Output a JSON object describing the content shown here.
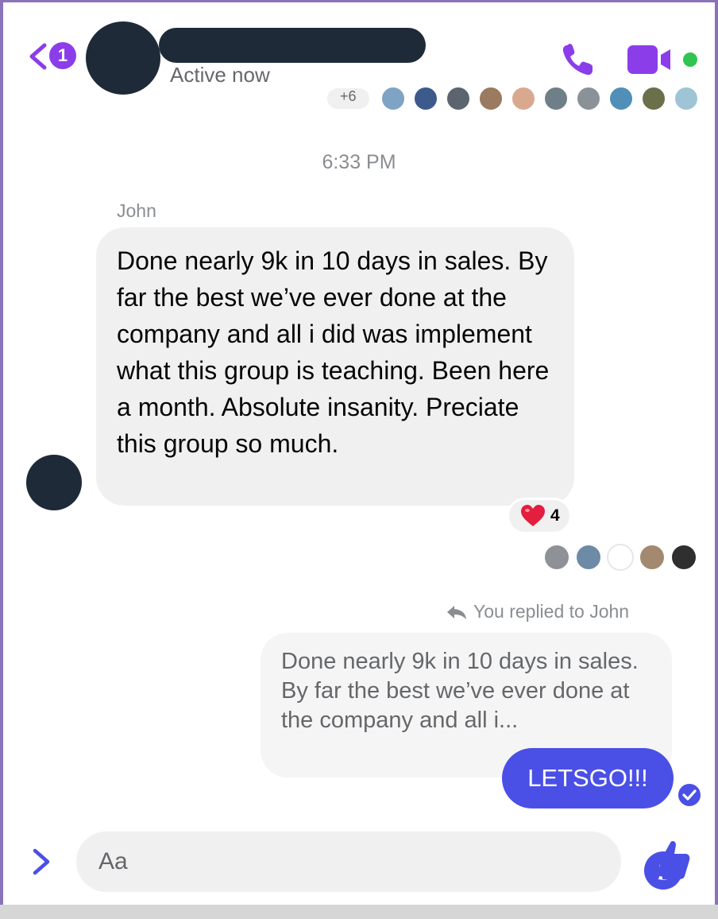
{
  "colors": {
    "accent": "#8b3dea",
    "outgoing_bubble": "#4a4fe6",
    "incoming_bubble": "#f0f0f0",
    "online": "#31c451",
    "redaction": "#1e2a38"
  },
  "header": {
    "back_badge_count": "1",
    "status": "Active now",
    "icons": [
      "chevron-left-icon",
      "phone-icon",
      "video-camera-icon"
    ]
  },
  "seen_top": {
    "extra_count": "+6"
  },
  "thread": {
    "timestamp": "6:33 PM",
    "sender_name": "John",
    "incoming_message": "Done nearly 9k in 10 days in sales. By far the best we’ve ever done at the company and all i did was implement what this group is teaching. Been here a month. Absolute insanity. Preciate this group so much.",
    "reaction_count": "4",
    "reaction_icon": "heart-icon",
    "reply_label": "You replied to John",
    "quoted_text": "Done nearly 9k in 10 days in sales. By far the best we’ve ever done at the company and all i...",
    "outgoing_message": "LETSGO!!!"
  },
  "composer": {
    "placeholder": "Aa",
    "icons": [
      "chevron-right-icon",
      "smiley-icon",
      "thumbs-up-icon"
    ]
  }
}
